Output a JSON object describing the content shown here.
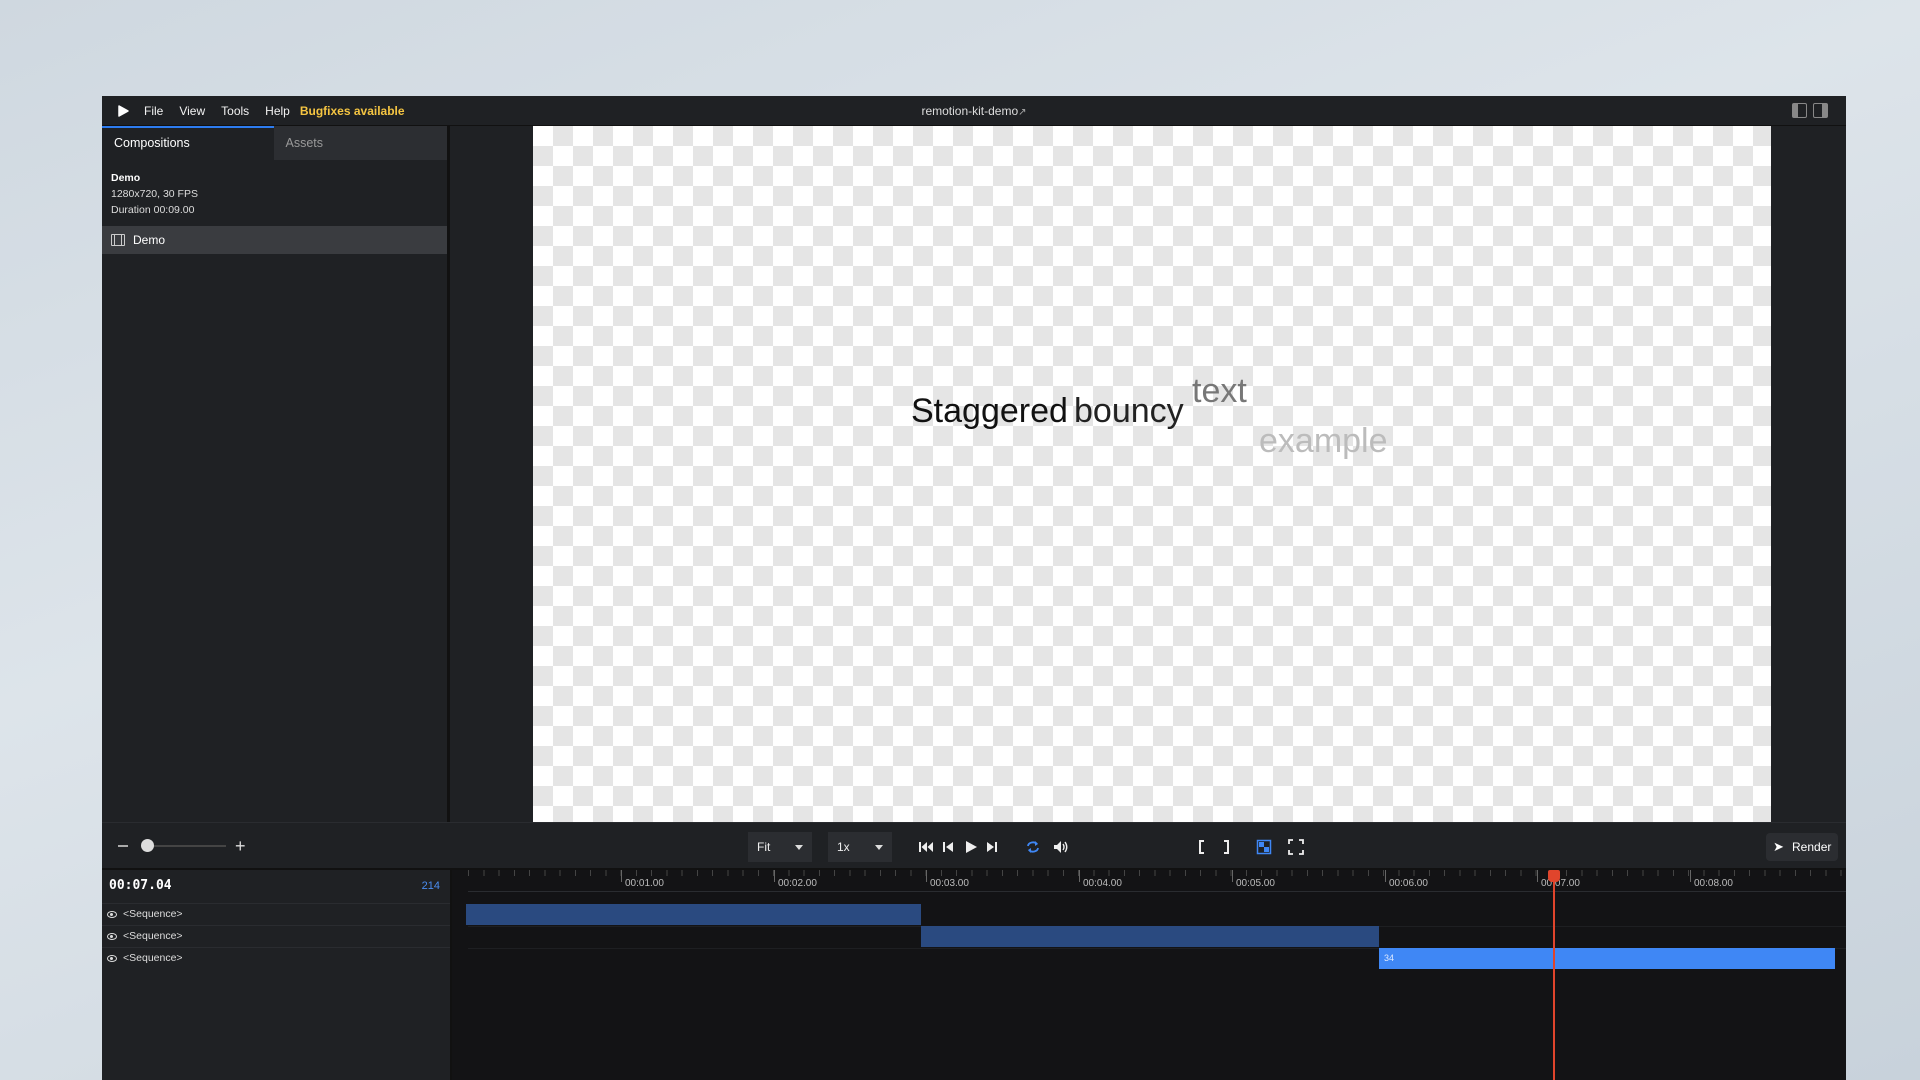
{
  "menu": {
    "items": [
      "File",
      "View",
      "Tools",
      "Help"
    ],
    "bugfix_label": "Bugfixes available",
    "title": "remotion-kit-demo"
  },
  "sidebar": {
    "tabs": [
      "Compositions",
      "Assets"
    ],
    "composition": {
      "name": "Demo",
      "resolution": "1280x720, 30 FPS",
      "duration": "Duration 00:09.00"
    },
    "items": [
      {
        "label": "Demo"
      }
    ]
  },
  "canvas": {
    "words": [
      "Staggered",
      "bouncy",
      "text",
      "example"
    ]
  },
  "controls": {
    "fit_label": "Fit",
    "rate_label": "1x",
    "render_label": "Render"
  },
  "timeline": {
    "timecode": "00:07.04",
    "frame": "214",
    "ticks": [
      "00:01.00",
      "00:02.00",
      "00:03.00",
      "00:04.00",
      "00:05.00",
      "00:06.00",
      "00:07.00",
      "00:08.00"
    ],
    "tracks": [
      {
        "label": "<Sequence>"
      },
      {
        "label": "<Sequence>"
      },
      {
        "label": "<Sequence>"
      }
    ],
    "active_sequence_label": "34"
  },
  "colors": {
    "accent": "#3f87f5",
    "bugfix": "#f5c542",
    "playhead": "#e0452c"
  }
}
